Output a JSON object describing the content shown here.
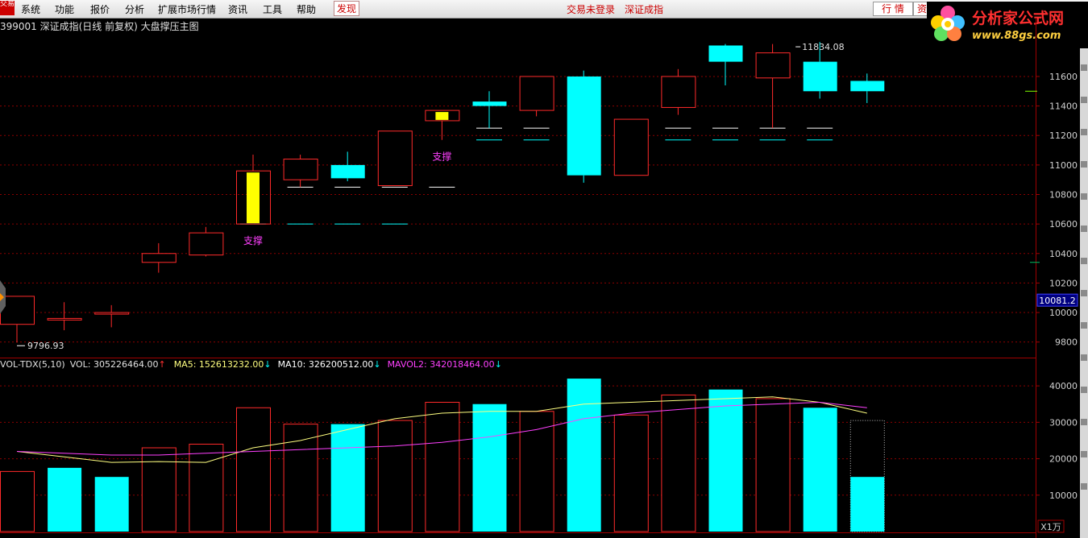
{
  "menubar": {
    "logo": "交易",
    "items": [
      "系统",
      "功能",
      "报价",
      "分析",
      "扩展市场行情",
      "资讯",
      "工具",
      "帮助"
    ],
    "discover": "发现",
    "status": "交易未登录",
    "instrument": "深证成指",
    "quote_button": "行 情",
    "info_button": "资"
  },
  "brand": {
    "name": "分析家公式网",
    "url": "www.88gs.com"
  },
  "chart_title": "399001 深证成指(日线 前复权) 大盘撑压主图",
  "colors": {
    "up": "#ff2a2a",
    "down": "#00ffff",
    "highlight": "#ffff00",
    "ma5": "#ffff80",
    "mavol2": "#ff40ff",
    "grid": "#8b0000",
    "support_text": "#ff40ff"
  },
  "price_axis": {
    "ticks": [
      "11600",
      "11400",
      "11200",
      "11000",
      "10800",
      "10600",
      "10400",
      "10200",
      "10000",
      "9800"
    ],
    "current_value_label": "10081.2"
  },
  "annotations": {
    "high_label": "11834.08",
    "low_label": "9796.93",
    "support_label": "支撑"
  },
  "volume_legend": {
    "indicator": "VOL-TDX(5,10)",
    "vol": "VOL: 305226464.00",
    "ma5": "MA5: 152613232.00",
    "ma10": "MA10: 326200512.00",
    "mavol2": "MAVOL2: 342018464.00"
  },
  "volume_axis": {
    "ticks": [
      "40000",
      "30000",
      "20000",
      "10000"
    ],
    "unit": "X1万"
  },
  "chart_data": [
    {
      "type": "candlestick",
      "title": "399001 深证成指(日线 前复权) 大盘撑压主图",
      "ylim": [
        9700,
        11900
      ],
      "candles": [
        {
          "open": 9920,
          "close": 10110,
          "high": 10110,
          "low": 9797
        },
        {
          "open": 9960,
          "close": 9960,
          "high": 10070,
          "low": 9880
        },
        {
          "open": 10000,
          "close": 10000,
          "high": 10050,
          "low": 9900
        },
        {
          "open": 10340,
          "close": 10400,
          "high": 10470,
          "low": 10270
        },
        {
          "open": 10390,
          "close": 10540,
          "high": 10580,
          "low": 10380
        },
        {
          "open": 10600,
          "close": 10960,
          "high": 11070,
          "low": 10600,
          "highlight": true
        },
        {
          "open": 10900,
          "close": 11040,
          "high": 11070,
          "low": 10850
        },
        {
          "open": 11000,
          "close": 10910,
          "high": 11090,
          "low": 10890
        },
        {
          "open": 10860,
          "close": 11230,
          "high": 11230,
          "low": 10860
        },
        {
          "open": 11300,
          "close": 11370,
          "high": 11370,
          "low": 11170,
          "highlight": true
        },
        {
          "open": 11430,
          "close": 11400,
          "high": 11500,
          "low": 11250
        },
        {
          "open": 11370,
          "close": 11600,
          "high": 11600,
          "low": 11330
        },
        {
          "open": 11600,
          "close": 10930,
          "high": 11640,
          "low": 10880
        },
        {
          "open": 10930,
          "close": 11310,
          "high": 11310,
          "low": 10930
        },
        {
          "open": 11390,
          "close": 11600,
          "high": 11650,
          "low": 11340
        },
        {
          "open": 11810,
          "close": 11700,
          "high": 11820,
          "low": 11540
        },
        {
          "open": 11590,
          "close": 11760,
          "high": 11820,
          "low": 11250
        },
        {
          "open": 11700,
          "close": 11500,
          "high": 11834,
          "low": 11450
        },
        {
          "open": 11570,
          "close": 11500,
          "high": 11620,
          "low": 11420
        }
      ],
      "support_levels": [
        {
          "from": 5,
          "to": 8,
          "value": 10600,
          "color": "#00ffff"
        },
        {
          "from": 6,
          "to": 9,
          "value": 10850,
          "color": "#ffffff"
        },
        {
          "from": 10,
          "to": 17,
          "value": 11250,
          "color": "#ffffff"
        },
        {
          "from": 10,
          "to": 17,
          "value": 11170,
          "color": "#00ffff"
        }
      ],
      "support_text_at": [
        5,
        9
      ]
    },
    {
      "type": "bar",
      "title": "VOL-TDX(5,10)",
      "unit": "X1万",
      "ylim": [
        0,
        46000
      ],
      "values": [
        16500,
        17500,
        15000,
        23000,
        24000,
        34000,
        29500,
        29500,
        30500,
        35500,
        35000,
        33000,
        42000,
        32000,
        37500,
        39000,
        36500,
        34000,
        30500
      ],
      "filled": [
        false,
        true,
        true,
        false,
        false,
        false,
        false,
        true,
        false,
        false,
        true,
        false,
        true,
        false,
        false,
        true,
        false,
        true,
        true
      ],
      "partial_current": 15000,
      "series": [
        {
          "name": "MA5",
          "values": [
            22000,
            20500,
            19000,
            19200,
            19000,
            23000,
            25000,
            28000,
            31000,
            32500,
            33000,
            33000,
            35000,
            35500,
            36000,
            36500,
            37000,
            35500,
            32500
          ]
        },
        {
          "name": "MAVOL2",
          "values": [
            22000,
            21500,
            21000,
            21000,
            21500,
            22000,
            22500,
            23000,
            23500,
            24500,
            26000,
            28000,
            31000,
            32500,
            33500,
            34500,
            35000,
            35500,
            34000
          ]
        }
      ]
    }
  ]
}
